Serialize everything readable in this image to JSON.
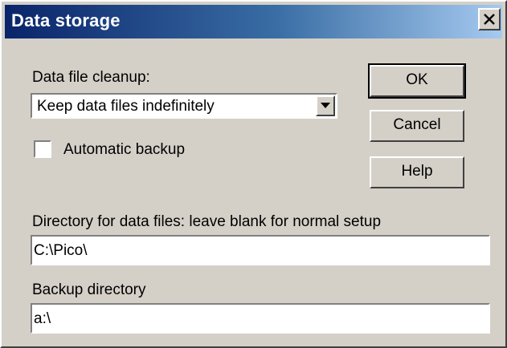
{
  "window": {
    "title": "Data storage"
  },
  "cleanup": {
    "label": "Data file cleanup:",
    "selected": "Keep data files indefinitely"
  },
  "backup_checkbox": {
    "label": "Automatic backup",
    "checked": false
  },
  "buttons": {
    "ok": "OK",
    "cancel": "Cancel",
    "help": "Help"
  },
  "data_directory": {
    "label": "Directory for data files: leave blank for normal setup",
    "value": "C:\\Pico\\"
  },
  "backup_directory": {
    "label": "Backup directory",
    "value": "a:\\"
  },
  "icons": {
    "close": "close-icon",
    "dropdown": "chevron-down-icon"
  },
  "colors": {
    "titlebar_start": "#0a246a",
    "titlebar_end": "#a6caf0",
    "face": "#d4d0c8"
  }
}
